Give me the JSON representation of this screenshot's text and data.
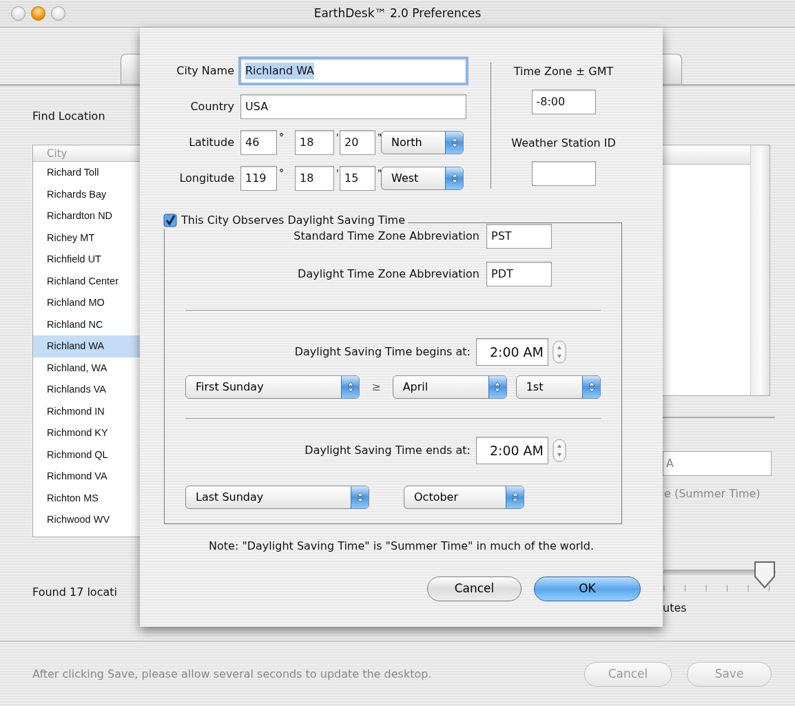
{
  "window": {
    "title": "EarthDesk™ 2.0 Preferences"
  },
  "background": {
    "find_label": "Find Location",
    "list_header": "City",
    "cities": [
      {
        "name": "Richard Toll",
        "selected": false
      },
      {
        "name": "Richards Bay",
        "selected": false
      },
      {
        "name": "Richardton ND",
        "selected": false
      },
      {
        "name": "Richey MT",
        "selected": false
      },
      {
        "name": "Richfield UT",
        "selected": false
      },
      {
        "name": "Richland Center",
        "selected": false
      },
      {
        "name": "Richland MO",
        "selected": false
      },
      {
        "name": "Richland NC",
        "selected": false
      },
      {
        "name": "Richland WA",
        "selected": true
      },
      {
        "name": "Richland, WA",
        "selected": false
      },
      {
        "name": "Richlands VA",
        "selected": false
      },
      {
        "name": "Richmond IN",
        "selected": false
      },
      {
        "name": "Richmond KY",
        "selected": false
      },
      {
        "name": "Richmond QL",
        "selected": false
      },
      {
        "name": "Richmond VA",
        "selected": false
      },
      {
        "name": "Richton MS",
        "selected": false
      },
      {
        "name": "Richwood WV",
        "selected": false
      }
    ],
    "found_text": "Found 17 locati",
    "partial_field_value": "A",
    "partial_label": "e (Summer Time)",
    "slider": {
      "level": 1
    },
    "slider_label": "utes",
    "footer_note": "After clicking Save, please allow several seconds to update the desktop.",
    "buttons": [
      {
        "label": "Cancel",
        "disabled": true
      },
      {
        "label": "Save",
        "disabled": true
      }
    ]
  },
  "sheet": {
    "city": {
      "label": "City Name",
      "value": "Richland WA"
    },
    "country": {
      "label": "Country",
      "value": "USA"
    },
    "coordinates": [
      {
        "label": "Latitude",
        "parts": [
          {
            "value": "46",
            "mark": "°"
          },
          {
            "value": "18",
            "mark": "'"
          },
          {
            "value": "20",
            "mark": "\""
          }
        ],
        "hemisphere": "North"
      },
      {
        "label": "Longitude",
        "parts": [
          {
            "value": "119",
            "mark": "°"
          },
          {
            "value": "18",
            "mark": "'"
          },
          {
            "value": "15",
            "mark": "\""
          }
        ],
        "hemisphere": "West"
      }
    ],
    "time_zone": {
      "label": "Time Zone ± GMT",
      "value": "-8:00"
    },
    "weather_station": {
      "label": "Weather Station ID"
    },
    "dst": {
      "checked": true,
      "label": "This City Observes Daylight Saving Time",
      "standard_abbr": {
        "label": "Standard Time Zone Abbreviation",
        "value": "PST"
      },
      "daylight_abbr": {
        "label": "Daylight Time Zone Abbreviation",
        "value": "PDT"
      },
      "begins": {
        "label": "Daylight Saving Time begins at:",
        "time": "2:00 AM",
        "week": "First Sunday",
        "relation": "≥",
        "month": "April",
        "day": "1st"
      },
      "ends": {
        "label": "Daylight Saving Time ends at:",
        "time": "2:00 AM",
        "week": "Last Sunday",
        "month": "October"
      }
    },
    "note": "Note: \"Daylight Saving Time\" is \"Summer Time\" in much of the world.",
    "buttons": [
      {
        "label": "Cancel",
        "default": false
      },
      {
        "label": "OK",
        "default": true
      }
    ]
  }
}
